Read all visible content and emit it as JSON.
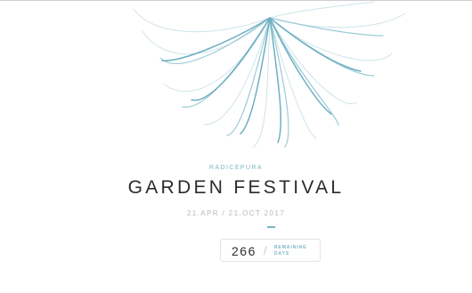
{
  "event": {
    "subtitle": "RADICEPURA",
    "title": "GARDEN FESTIVAL",
    "dates": "21.APR / 21.OCT 2017"
  },
  "countdown": {
    "value": "266",
    "separator": "/",
    "label_line1": "REMAINING",
    "label_line2": "DAYS"
  },
  "colors": {
    "accent": "#7ab7c6",
    "title": "#2b2b2b",
    "muted": "#b8b8b8"
  },
  "icons": {
    "flower": "flower-line-art-icon"
  }
}
